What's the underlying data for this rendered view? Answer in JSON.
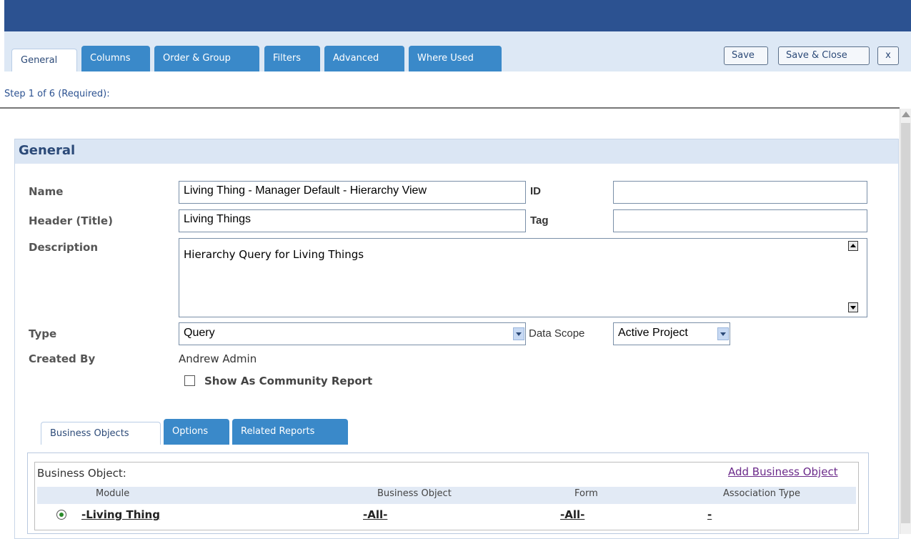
{
  "tabs": [
    {
      "label": "General",
      "active": true
    },
    {
      "label": "Columns"
    },
    {
      "label": "Order & Group"
    },
    {
      "label": "Filters"
    },
    {
      "label": "Advanced"
    },
    {
      "label": "Where Used"
    }
  ],
  "toolbar": {
    "save": "Save",
    "save_close": "Save & Close",
    "close": "x"
  },
  "step_text": "Step 1 of 6 (Required):",
  "section_title": "General",
  "form": {
    "name_label": "Name",
    "name_value": "Living Thing - Manager Default - Hierarchy View",
    "id_label": "ID",
    "id_value": "",
    "header_label": "Header (Title)",
    "header_value": "Living Things",
    "tag_label": "Tag",
    "tag_value": "",
    "description_label": "Description",
    "description_value": "Hierarchy Query for Living Things",
    "type_label": "Type",
    "type_value": "Query",
    "data_scope_label": "Data Scope",
    "data_scope_value": "Active Project",
    "created_by_label": "Created By",
    "created_by_value": "Andrew Admin",
    "community_label": "Show As Community Report"
  },
  "subtabs": [
    {
      "label": "Business Objects",
      "active": true
    },
    {
      "label": "Options"
    },
    {
      "label": "Related Reports"
    }
  ],
  "business": {
    "label": "Business Object:",
    "add_link": "Add Business Object",
    "columns": [
      "Module",
      "Business Object",
      "Form",
      "Association Type"
    ],
    "rows": [
      {
        "module": "-Living Thing",
        "business_object": "-All-",
        "form": "-All-",
        "association_type": "-"
      }
    ]
  },
  "colors": {
    "top_band": "#2c5291",
    "tab_blue": "#3a89c9",
    "header_bg": "#dbe6f4",
    "link_purple": "#6b2a8a"
  }
}
